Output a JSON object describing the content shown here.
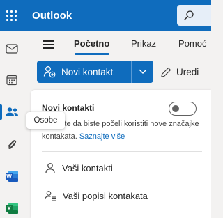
{
  "topbar": {
    "app_title": "Outlook",
    "colors": {
      "brand": "#0f6cbd"
    }
  },
  "rail": {
    "items": [
      {
        "name": "mail",
        "icon": "mail-icon"
      },
      {
        "name": "calendar",
        "icon": "calendar-icon"
      },
      {
        "name": "people",
        "icon": "people-icon",
        "active": true
      },
      {
        "name": "attachments",
        "icon": "paperclip-icon"
      },
      {
        "name": "word",
        "icon": "word-icon"
      },
      {
        "name": "excel",
        "icon": "excel-icon"
      }
    ],
    "tooltip": "Osobe"
  },
  "ribbon": {
    "tabs": [
      {
        "label": "Početno",
        "active": true
      },
      {
        "label": "Prikaz"
      },
      {
        "label": "Pomoć"
      }
    ],
    "new_contact_label": "Novi kontakt",
    "edit_label": "Uredi"
  },
  "panel": {
    "promo_title": "Novi kontakti",
    "promo_text": "Uključite da biste počeli koristiti nove značajke kontakata.",
    "promo_link": "Saznajte više",
    "toggle_on": false,
    "nav_items": [
      {
        "label": "Vaši kontakti",
        "icon": "person-icon"
      },
      {
        "label": "Vaši popisi kontakata",
        "icon": "people-list-icon"
      }
    ]
  }
}
